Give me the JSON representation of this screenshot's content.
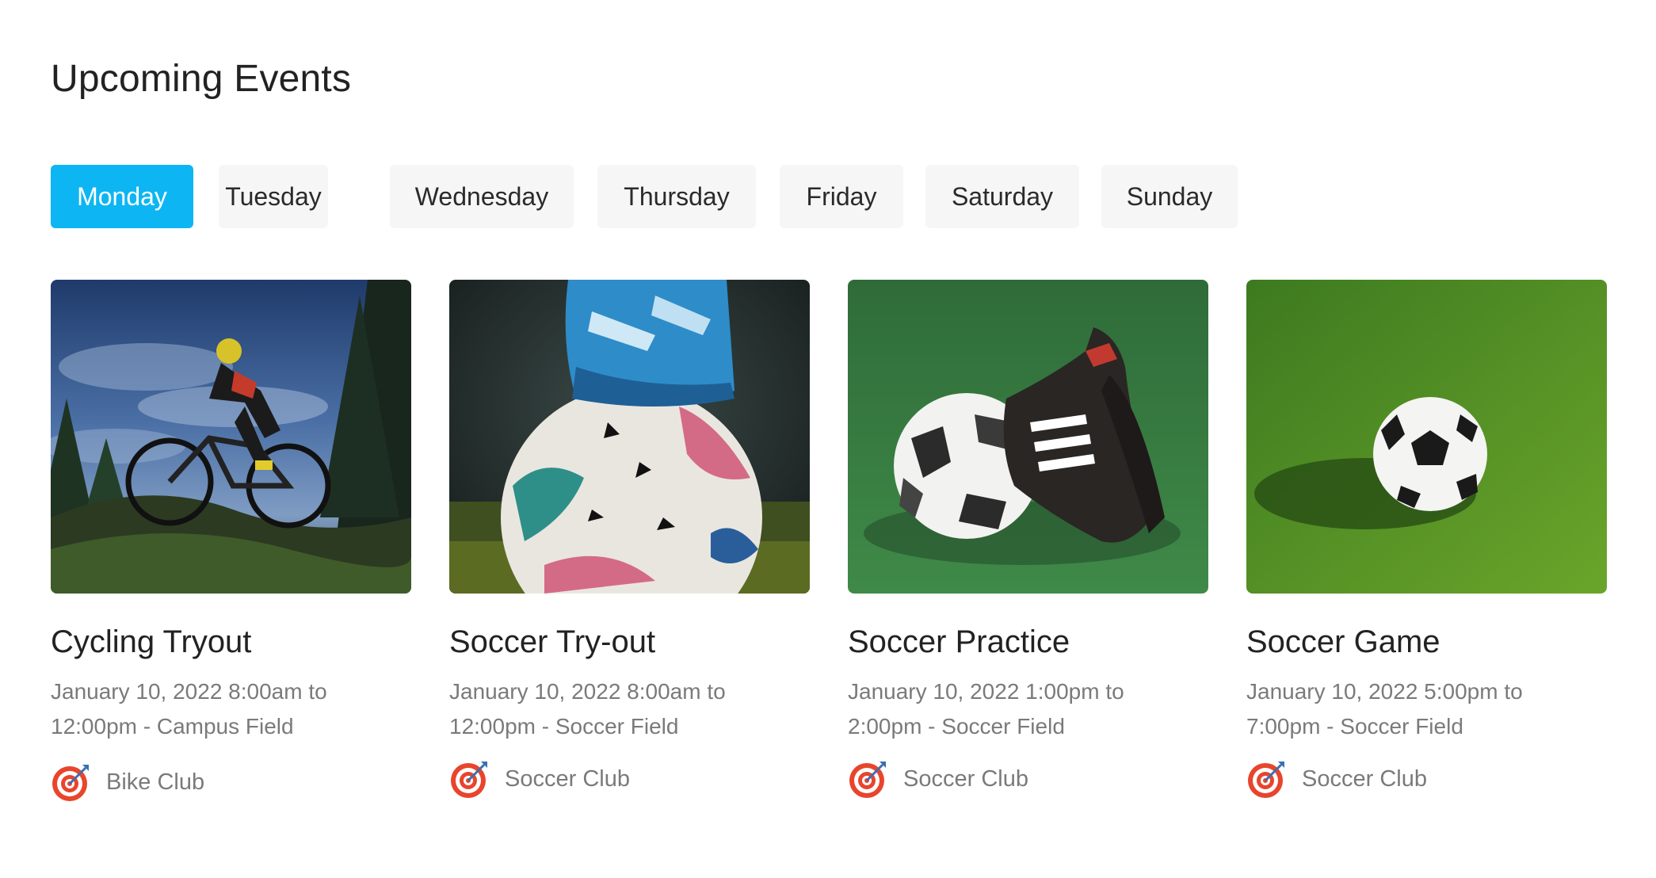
{
  "page": {
    "title": "Upcoming Events"
  },
  "tabs": [
    {
      "label": "Monday",
      "active": true
    },
    {
      "label": "Tuesday",
      "active": false
    },
    {
      "label": "Wednesday",
      "active": false
    },
    {
      "label": "Thursday",
      "active": false
    },
    {
      "label": "Friday",
      "active": false
    },
    {
      "label": "Saturday",
      "active": false
    },
    {
      "label": "Sunday",
      "active": false
    }
  ],
  "colors": {
    "accent": "#0db6f3",
    "tab_bg": "#f6f6f6",
    "meta_text": "#7a7a7a",
    "icon_red": "#e8452c"
  },
  "events": [
    {
      "title": "Cycling Tryout",
      "when_line1": "January 10, 2022  8:00am to",
      "when_line2": "12:00pm - Campus Field",
      "club": "Bike Club",
      "club_icon": "target-icon",
      "image": "mountain-biker-photo"
    },
    {
      "title": "Soccer Try-out",
      "when_line1": "January 10, 2022  8:00am to",
      "when_line2": "12:00pm - Soccer Field",
      "club": "Soccer Club",
      "club_icon": "target-icon",
      "image": "cleat-on-soccer-ball-photo"
    },
    {
      "title": "Soccer Practice",
      "when_line1": "January 10, 2022  1:00pm to",
      "when_line2": "2:00pm - Soccer Field",
      "club": "Soccer Club",
      "club_icon": "target-icon",
      "image": "ball-and-cleats-on-grass-photo"
    },
    {
      "title": "Soccer Game",
      "when_line1": "January 10, 2022  5:00pm to",
      "when_line2": "7:00pm - Soccer Field",
      "club": "Soccer Club",
      "club_icon": "target-icon",
      "image": "ball-on-grass-photo"
    }
  ]
}
